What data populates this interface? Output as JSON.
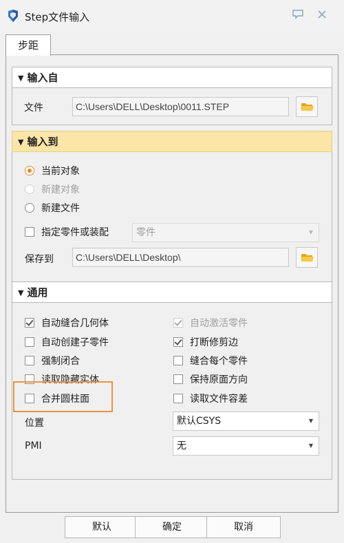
{
  "window": {
    "title": "Step文件输入",
    "help_icon": "comment-icon",
    "close_icon": "close-icon"
  },
  "tabs": [
    {
      "label": "步距",
      "active": true
    }
  ],
  "input_from": {
    "header": "输入自",
    "file_label": "文件",
    "file_value": "C:\\Users\\DELL\\Desktop\\0011.STEP"
  },
  "input_to": {
    "header": "输入到",
    "options": [
      {
        "label": "当前对象",
        "checked": true,
        "disabled": false
      },
      {
        "label": "新建对象",
        "checked": false,
        "disabled": true
      },
      {
        "label": "新建文件",
        "checked": false,
        "disabled": false
      }
    ],
    "specify_part_label": "指定零件或装配",
    "specify_part_checked": false,
    "part_select_value": "零件",
    "save_to_label": "保存到",
    "save_to_value": "C:\\Users\\DELL\\Desktop\\"
  },
  "general": {
    "header": "通用",
    "left_options": [
      {
        "label": "自动缝合几何体",
        "checked": true,
        "disabled": false
      },
      {
        "label": "自动创建子零件",
        "checked": false,
        "disabled": false
      },
      {
        "label": "强制闭合",
        "checked": false,
        "disabled": false
      },
      {
        "label": "读取隐藏实体",
        "checked": false,
        "disabled": false
      },
      {
        "label": "合并圆柱面",
        "checked": false,
        "disabled": false
      }
    ],
    "right_options": [
      {
        "label": "自动激活零件",
        "checked": true,
        "disabled": true
      },
      {
        "label": "打断修剪边",
        "checked": true,
        "disabled": false
      },
      {
        "label": "缝合每个零件",
        "checked": false,
        "disabled": false
      },
      {
        "label": "保持原面方向",
        "checked": false,
        "disabled": false
      },
      {
        "label": "读取文件容差",
        "checked": false,
        "disabled": false
      }
    ],
    "position_label": "位置",
    "position_value": "默认CSYS",
    "pmi_label": "PMI",
    "pmi_value": "无"
  },
  "buttons": {
    "default": "默认",
    "ok": "确定",
    "cancel": "取消"
  },
  "colors": {
    "accent": "#e4892d",
    "highlight_header": "#fbe5a7",
    "annotation_box": "#f0913c"
  }
}
